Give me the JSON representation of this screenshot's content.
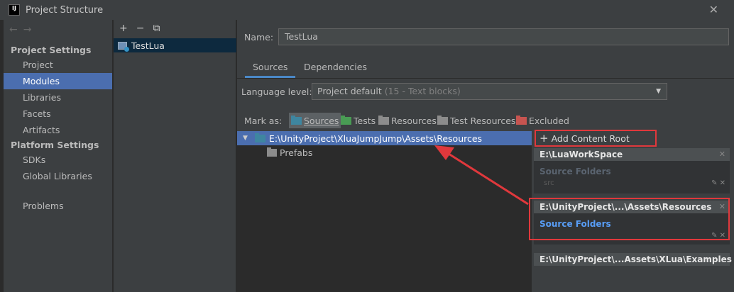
{
  "window": {
    "title": "Project Structure",
    "app_icon": "IJ"
  },
  "nav": {
    "back": "←",
    "forward": "→"
  },
  "sidebar": {
    "section_project": "Project Settings",
    "project_items": [
      {
        "label": "Project"
      },
      {
        "label": "Modules"
      },
      {
        "label": "Libraries"
      },
      {
        "label": "Facets"
      },
      {
        "label": "Artifacts"
      }
    ],
    "section_platform": "Platform Settings",
    "platform_items": [
      {
        "label": "SDKs"
      },
      {
        "label": "Global Libraries"
      }
    ],
    "problems": "Problems"
  },
  "modules": {
    "add": "+",
    "remove": "−",
    "copy": "⧉",
    "items": [
      {
        "label": "TestLua"
      }
    ]
  },
  "module": {
    "name_label": "Name:",
    "name_value": "TestLua",
    "tabs": [
      {
        "label": "Sources"
      },
      {
        "label": "Dependencies"
      }
    ],
    "language_label": "Language level:",
    "language_value": "Project default",
    "language_hint": "(15 - Text blocks)",
    "mark_label": "Mark as:",
    "mark_buttons": [
      {
        "label": "Sources",
        "color": "#3e86a0"
      },
      {
        "label": "Tests",
        "color": "#499c54"
      },
      {
        "label": "Resources",
        "color": "#8c8c8c"
      },
      {
        "label": "Test Resources",
        "color": "#8c8c8c"
      },
      {
        "label": "Excluded",
        "color": "#c75450"
      }
    ]
  },
  "tree": {
    "root_path": "E:\\UnityProject\\XluaJumpJump\\Assets\\Resources",
    "child": "Prefabs"
  },
  "content_roots": {
    "add_label": "Add Content Root",
    "roots": [
      {
        "header": "E:\\LuaWorkSpace",
        "folders_title": "Source Folders",
        "folder": "src"
      },
      {
        "header": "E:\\UnityProject\\...\\Assets\\Resources",
        "folders_title": "Source Folders"
      },
      {
        "header": "E:\\UnityProject\\...Assets\\XLua\\Examples"
      }
    ],
    "close": "✕"
  },
  "annotation_color": "#e0383c"
}
